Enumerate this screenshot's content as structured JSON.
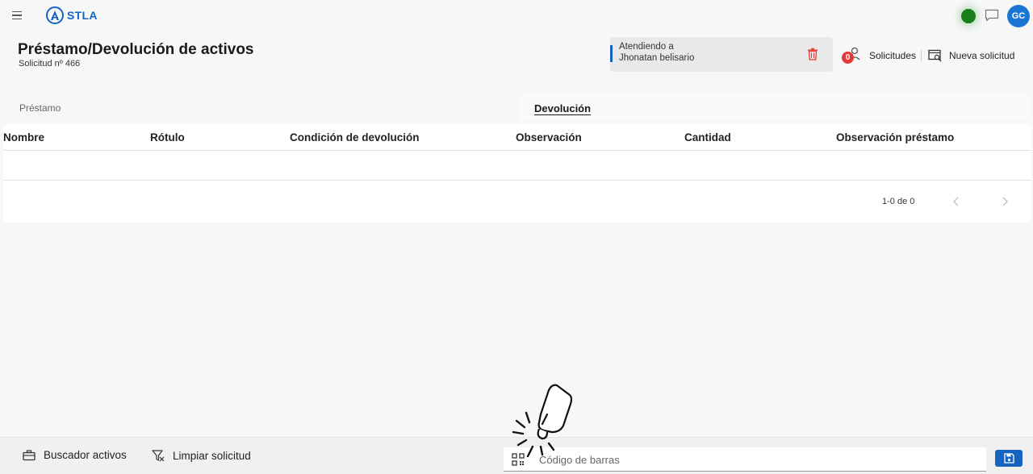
{
  "app": {
    "brand": "STLA",
    "avatar_initials": "GC"
  },
  "header": {
    "title": "Préstamo/Devolución de activos",
    "subtitle": "Solicitud nº 466"
  },
  "attending": {
    "line1": "Atendiendo a",
    "line2": "Jhonatan belisario"
  },
  "actions": {
    "requests_count": "0",
    "requests_label": "Solicitudes",
    "new_request_label": "Nueva solicitud"
  },
  "tabs": [
    {
      "label": "Préstamo",
      "active": false
    },
    {
      "label": "Devolución",
      "active": true
    }
  ],
  "table": {
    "columns": [
      "Nombre",
      "Rótulo",
      "Condición de devolución",
      "Observación",
      "Cantidad",
      "Observación préstamo"
    ],
    "rows": [],
    "pagination": "1-0 de 0"
  },
  "bottom": {
    "search_assets_label": "Buscador activos",
    "clear_request_label": "Limpiar solicitud",
    "barcode_placeholder": "Código de barras"
  },
  "colors": {
    "primary": "#1565c0",
    "status_online": "#1b7f1b",
    "badge": "#e53935",
    "delete": "#e53935"
  }
}
